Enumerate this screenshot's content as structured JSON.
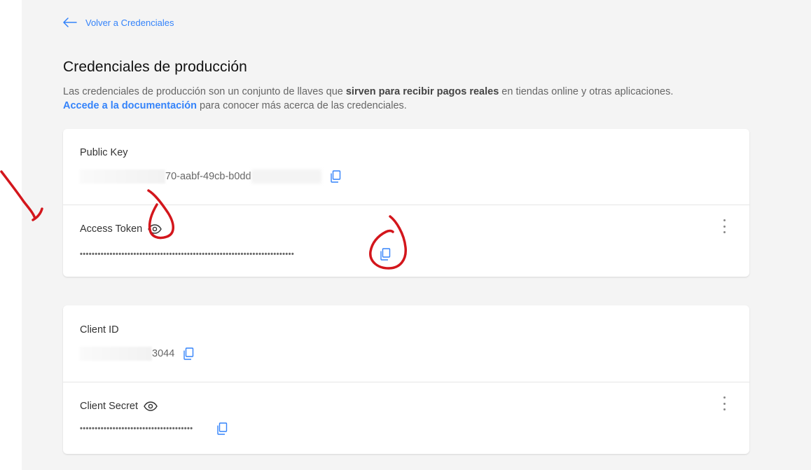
{
  "nav": {
    "back_label": "Volver a Credenciales"
  },
  "page": {
    "title": "Credenciales de producción",
    "desc_part1": "Las credenciales de producción son un conjunto de llaves que ",
    "desc_bold": "sirven para recibir pagos reales",
    "desc_part2": " en tiendas online y otras aplicaciones.",
    "doc_link": "Accede a la documentación",
    "desc_part3": " para conocer más acerca de las credenciales."
  },
  "credentials": {
    "public_key": {
      "label": "Public Key",
      "value_visible": "70-aabf-49cb-b0dd"
    },
    "access_token": {
      "label": "Access Token",
      "masked": "••••••••••••••••••••••••••••••••••••••••••••••••••••••••••••••••••••••••"
    },
    "client_id": {
      "label": "Client ID",
      "value_visible": "3044"
    },
    "client_secret": {
      "label": "Client Secret",
      "masked": "••••••••••••••••••••••••••••••••••••••"
    }
  },
  "theme": {
    "accent": "#3483fa",
    "annotation": "#d3161c",
    "background": "#f4f4f4"
  },
  "icons": [
    "arrow-left-icon",
    "copy-icon",
    "eye-icon",
    "more-vertical-icon"
  ]
}
